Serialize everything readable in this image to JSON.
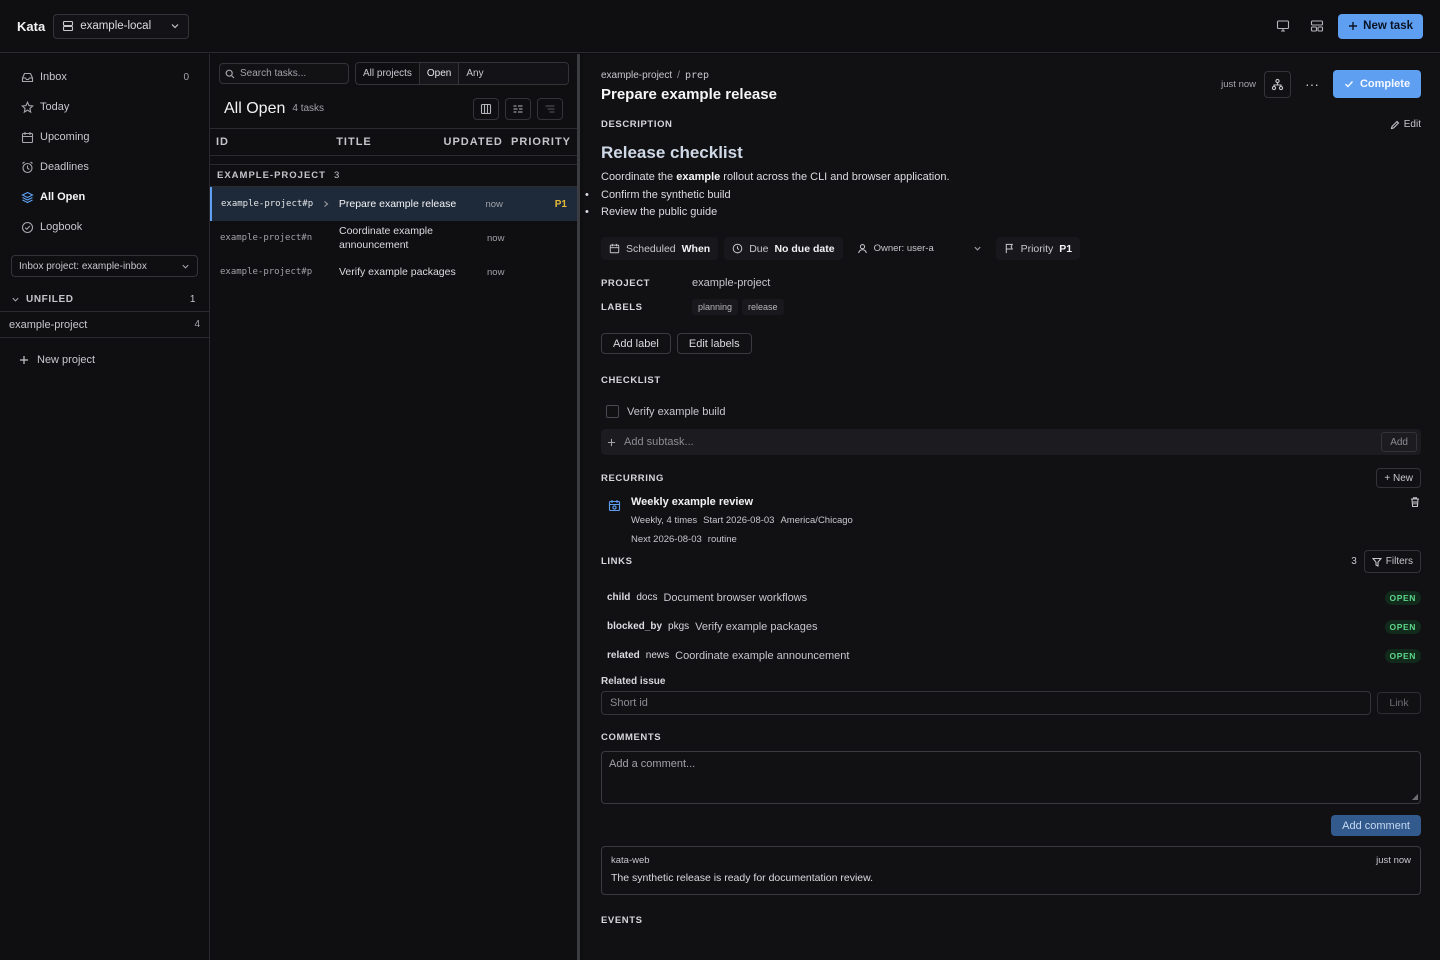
{
  "topbar": {
    "brand": "Kata",
    "workspace": "example-local",
    "new_task_label": "New task"
  },
  "sidebar": {
    "nav": [
      {
        "label": "Inbox",
        "count": "0",
        "icon": "inbox-icon"
      },
      {
        "label": "Today",
        "count": "",
        "icon": "star-icon"
      },
      {
        "label": "Upcoming",
        "count": "",
        "icon": "calendar-icon"
      },
      {
        "label": "Deadlines",
        "count": "",
        "icon": "alarm-icon"
      },
      {
        "label": "All Open",
        "count": "",
        "icon": "layers-icon"
      },
      {
        "label": "Logbook",
        "count": "",
        "icon": "check-circle-icon"
      }
    ],
    "inbox_project": "Inbox project: example-inbox",
    "unfiled_label": "UNFILED",
    "unfiled_count": "1",
    "project": {
      "name": "example-project",
      "count": "4"
    },
    "new_project_label": "New project"
  },
  "list": {
    "search_placeholder": "Search tasks...",
    "filter_project": "All projects",
    "filter_status": "Open",
    "filter_priority": "Any",
    "title": "All Open",
    "count_label": "4 tasks",
    "columns": {
      "id": "ID",
      "title": "TITLE",
      "updated": "UPDATED",
      "priority": "PRIORITY"
    },
    "group": {
      "name": "EXAMPLE-PROJECT",
      "count": "3"
    },
    "rows": [
      {
        "id": "example-project#p",
        "title": "Prepare example release",
        "updated": "now",
        "priority": "P1"
      },
      {
        "id": "example-project#n",
        "title": "Coordinate example announcement",
        "updated": "now",
        "priority": ""
      },
      {
        "id": "example-project#p",
        "title": "Verify example packages",
        "updated": "now",
        "priority": ""
      }
    ]
  },
  "detail": {
    "breadcrumb_project": "example-project",
    "breadcrumb_sep": "/",
    "breadcrumb_tag": "prep",
    "title": "Prepare example release",
    "updated": "just now",
    "complete_label": "Complete",
    "description_label": "DESCRIPTION",
    "edit_label": "Edit",
    "description": {
      "heading": "Release checklist",
      "para_before": "Coordinate the ",
      "para_bold": "example",
      "para_after": " rollout across the CLI and browser application.",
      "bullets": [
        "Confirm the synthetic build",
        "Review the public guide"
      ]
    },
    "chips": {
      "scheduled_label": "Scheduled",
      "scheduled_value": "When",
      "due_label": "Due",
      "due_value": "No due date",
      "owner": "Owner: user-a",
      "priority_label": "Priority",
      "priority_value": "P1"
    },
    "project_key": "PROJECT",
    "project_value": "example-project",
    "labels_key": "LABELS",
    "labels": [
      "planning",
      "release"
    ],
    "add_label": "Add label",
    "edit_labels": "Edit labels",
    "checklist_label": "CHECKLIST",
    "checklist_items": [
      "Verify example build"
    ],
    "subtask_placeholder": "Add subtask...",
    "subtask_add": "Add",
    "recurring_label": "RECURRING",
    "recurring_new": "+ New",
    "recurring": {
      "title": "Weekly example review",
      "freq": "Weekly, 4 times",
      "start": "Start 2026-08-03",
      "tz": "America/Chicago",
      "next": "Next 2026-08-03",
      "kind": "routine"
    },
    "links_label": "LINKS",
    "links_count": "3",
    "filters_label": "Filters",
    "links": [
      {
        "rel": "child",
        "project": "docs",
        "title": "Document browser workflows",
        "status": "OPEN"
      },
      {
        "rel": "blocked_by",
        "project": "pkgs",
        "title": "Verify example packages",
        "status": "OPEN"
      },
      {
        "rel": "related",
        "project": "news",
        "title": "Coordinate example announcement",
        "status": "OPEN"
      }
    ],
    "related_label": "Related issue",
    "related_placeholder": "Short id",
    "related_button": "Link",
    "comments_label": "COMMENTS",
    "comment_placeholder": "Add a comment...",
    "add_comment": "Add comment",
    "comment": {
      "author": "kata-web",
      "time": "just now",
      "text": "The synthetic release is ready for documentation review."
    },
    "events_label": "EVENTS"
  },
  "colors": {
    "accent": "#5e9ff2",
    "priority": "#e5b93a",
    "open_badge": "#5ed78a"
  }
}
